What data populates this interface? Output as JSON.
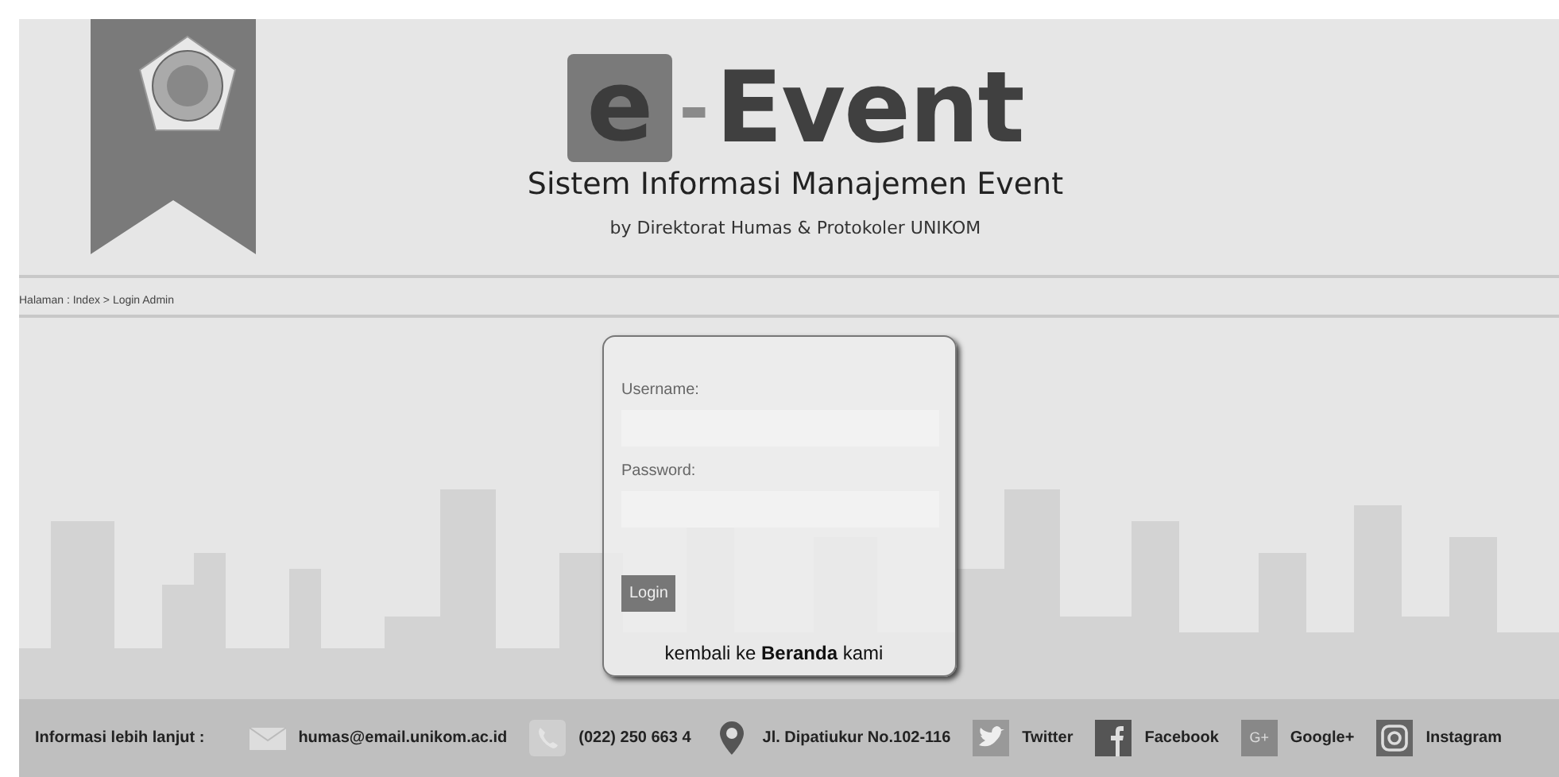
{
  "header": {
    "logo": {
      "letter": "e",
      "dash": "-",
      "word": "Event"
    },
    "subtitle": "Sistem Informasi Manajemen Event",
    "byline": "by Direktorat Humas & Protokoler UNIKOM"
  },
  "breadcrumb": "Halaman : Index > Login Admin",
  "login": {
    "fields": [
      {
        "label": "Username:"
      },
      {
        "label": "Password:"
      }
    ],
    "button": "Login",
    "back_link": "kembali ke **Beranda** kami"
  },
  "footer": {
    "label": "Informasi lebih lanjut :",
    "items": [
      {
        "kind": "email",
        "text": "humas@email.unikom.ac.id"
      },
      {
        "kind": "phone",
        "text": "(022) 250 663 4"
      },
      {
        "kind": "location",
        "text": "Jl. Dipatiukur No.102-116"
      },
      {
        "kind": "twitter",
        "text": "Twitter"
      },
      {
        "kind": "facebook",
        "text": "Facebook"
      },
      {
        "kind": "googleplus",
        "text": "Google+",
        "icon_text": "G+"
      },
      {
        "kind": "instagram",
        "text": "Instagram"
      }
    ]
  }
}
